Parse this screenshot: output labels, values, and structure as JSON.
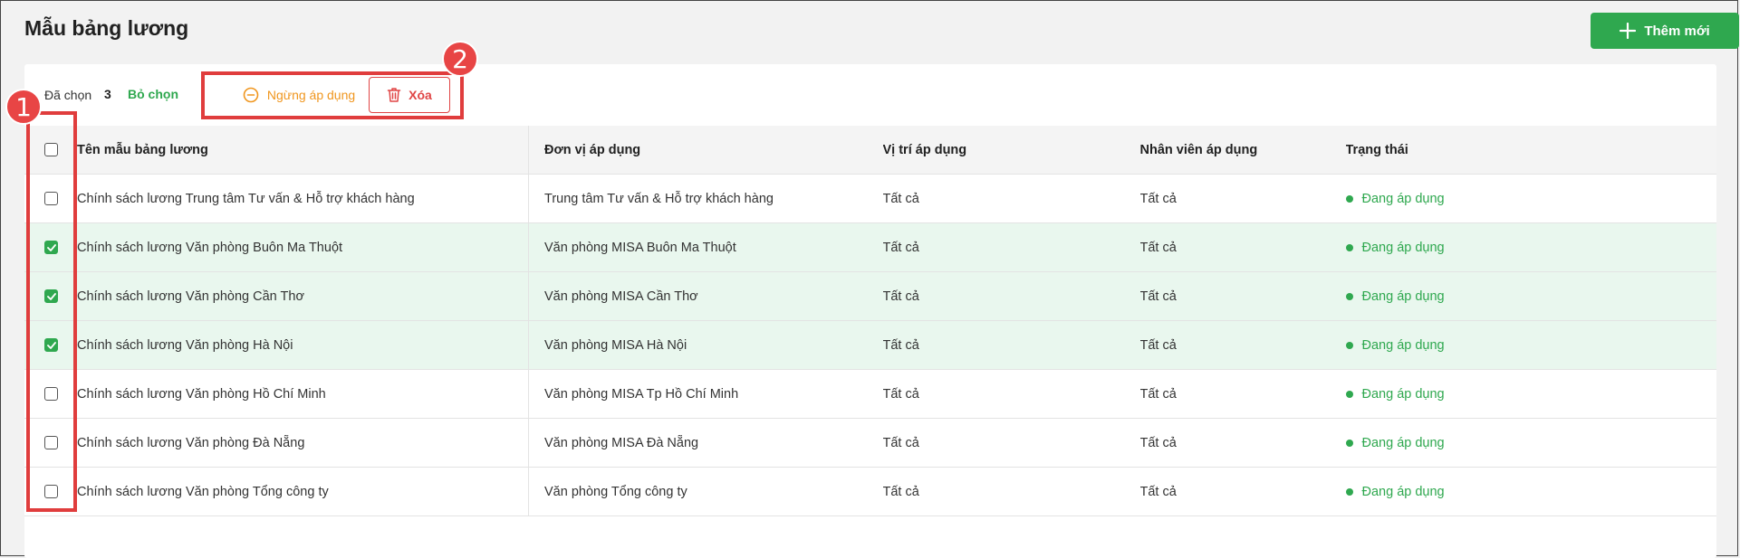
{
  "header": {
    "title": "Mẫu bảng lương",
    "add_label": "Thêm mới"
  },
  "selection": {
    "label": "Đã chọn",
    "count": "3",
    "unselect_label": "Bỏ chọn",
    "stop_label": "Ngừng áp dụng",
    "delete_label": "Xóa"
  },
  "annotations": {
    "badge1": "1",
    "badge2": "2"
  },
  "table": {
    "columns": [
      "Tên mẫu bảng lương",
      "Đơn vị áp dụng",
      "Vị trí áp dụng",
      "Nhân viên áp dụng",
      "Trạng thái"
    ],
    "rows": [
      {
        "checked": false,
        "name": "Chính sách lương Trung tâm Tư vấn & Hỗ trợ khách hàng",
        "unit": "Trung tâm Tư vấn & Hỗ trợ khách hàng",
        "position": "Tất cả",
        "employee": "Tất cả",
        "status": "Đang áp dụng"
      },
      {
        "checked": true,
        "name": "Chính sách lương Văn phòng Buôn Ma Thuột",
        "unit": "Văn phòng MISA Buôn Ma Thuột",
        "position": "Tất cả",
        "employee": "Tất cả",
        "status": "Đang áp dụng"
      },
      {
        "checked": true,
        "name": "Chính sách lương Văn phòng Cần Thơ",
        "unit": "Văn phòng MISA Cần Thơ",
        "position": "Tất cả",
        "employee": "Tất cả",
        "status": "Đang áp dụng"
      },
      {
        "checked": true,
        "name": "Chính sách lương Văn phòng Hà Nội",
        "unit": "Văn phòng MISA Hà Nội",
        "position": "Tất cả",
        "employee": "Tất cả",
        "status": "Đang áp dụng"
      },
      {
        "checked": false,
        "name": "Chính sách lương Văn phòng Hồ Chí Minh",
        "unit": "Văn phòng MISA Tp Hồ Chí Minh",
        "position": "Tất cả",
        "employee": "Tất cả",
        "status": "Đang áp dụng"
      },
      {
        "checked": false,
        "name": "Chính sách lương Văn phòng Đà Nẵng",
        "unit": "Văn phòng MISA Đà Nẵng",
        "position": "Tất cả",
        "employee": "Tất cả",
        "status": "Đang áp dụng"
      },
      {
        "checked": false,
        "name": "Chính sách lương Văn phòng Tổng công ty",
        "unit": "Văn phòng Tổng công ty",
        "position": "Tất cả",
        "employee": "Tất cả",
        "status": "Đang áp dụng"
      }
    ]
  },
  "colors": {
    "accent": "#2fa84f",
    "stop": "#f0961e",
    "danger": "#e04545",
    "annotation": "#e03d3d"
  },
  "icons": {
    "add": "plus-icon",
    "stop": "minus-circle-icon",
    "delete": "trash-icon",
    "checked": "check-icon"
  }
}
